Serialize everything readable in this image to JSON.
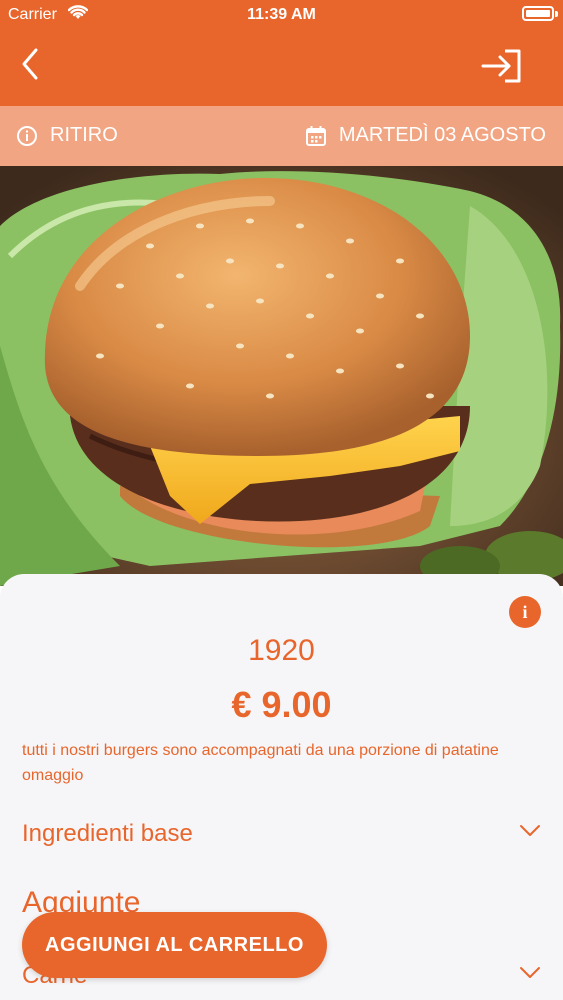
{
  "status_bar": {
    "carrier": "Carrier",
    "time": "11:39 AM"
  },
  "info_bar": {
    "mode": "RITIRO",
    "date": "MARTEDÌ 03 AGOSTO"
  },
  "product": {
    "name": "1920",
    "price": "€ 9.00",
    "description": "tutti i nostri burgers sono accompagnati da una porzione di patatine omaggio"
  },
  "sections": {
    "base_ingredients": "Ingredienti base",
    "additions": "Aggiunte",
    "meat": "Carne"
  },
  "actions": {
    "add_to_cart": "AGGIUNGI AL CARRELLO"
  },
  "colors": {
    "accent": "#e8662c",
    "info_bar": "#f1a582",
    "sheet_bg": "#f6f6f8"
  }
}
